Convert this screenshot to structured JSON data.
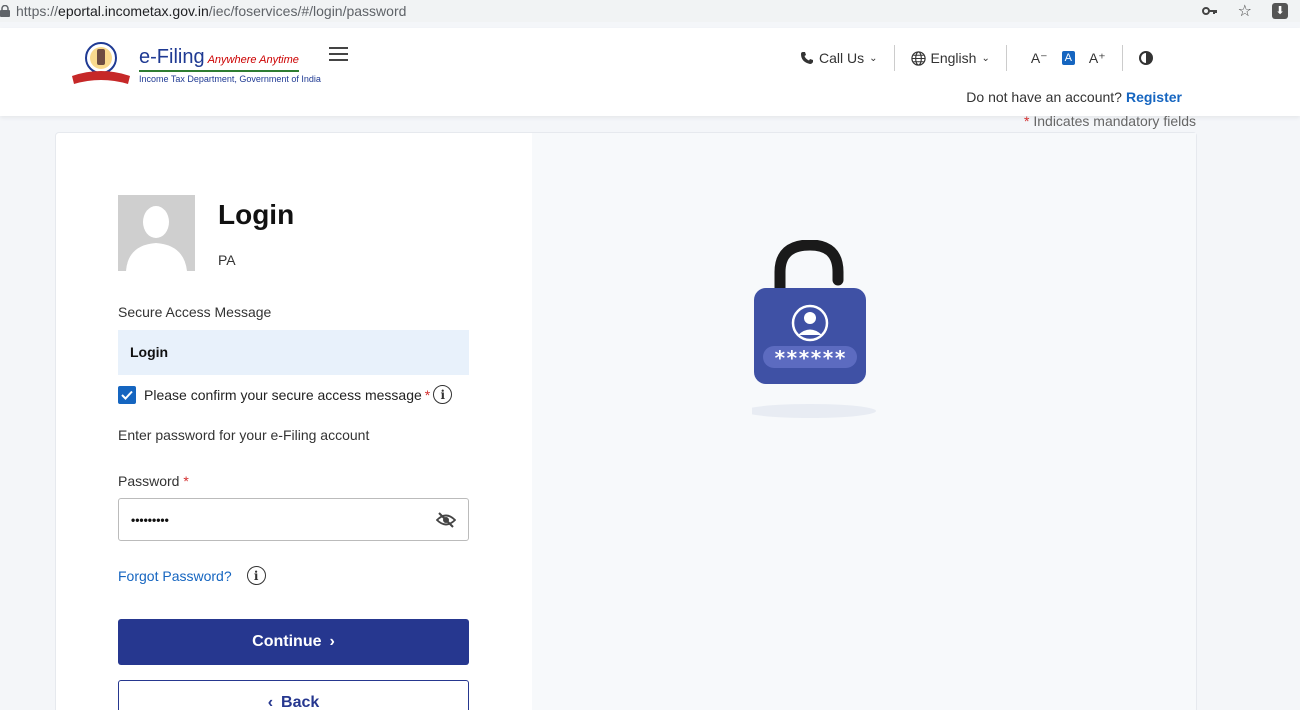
{
  "browser": {
    "url_scheme": "https://",
    "url_host": "eportal.incometax.gov.in",
    "url_path": "/iec/foservices/#/login/password"
  },
  "header": {
    "brand_name": "e-Filing",
    "brand_tagline": "Anywhere Anytime",
    "brand_dept": "Income Tax Department, Government of India",
    "call_us": "Call Us",
    "language": "English",
    "font_decrease": "A⁻",
    "font_normal": "A",
    "font_increase": "A⁺",
    "account_prompt": "Do not have an account?",
    "register": "Register"
  },
  "mandatory_note": "Indicates mandatory fields",
  "login": {
    "title": "Login",
    "user_id": "PA",
    "secure_access_label": "Secure Access Message",
    "secure_access_value": "Login",
    "confirm_label": "Please confirm your secure access message",
    "confirm_checked": true,
    "enter_password_text": "Enter password for your e-Filing account",
    "password_label": "Password",
    "password_value": "•••••••••",
    "forgot_password": "Forgot Password?",
    "continue": "Continue",
    "back": "Back"
  },
  "illustration": {
    "masked_text": "******"
  },
  "colors": {
    "primary": "#26378f",
    "link": "#1565c0",
    "lock_body": "#3f51a5",
    "required": "#d32f2f"
  }
}
